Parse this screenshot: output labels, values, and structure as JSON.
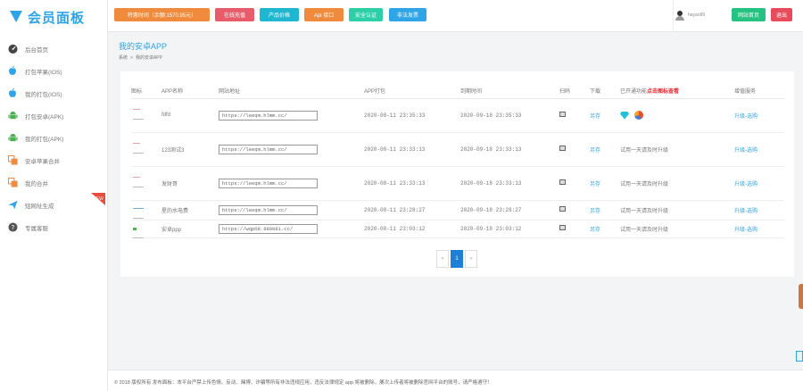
{
  "logo": {
    "text": "会员面板"
  },
  "sidebar": {
    "items": [
      {
        "label": "后台首页",
        "icon": "dashboard-icon"
      },
      {
        "label": "打包苹果(IOS)",
        "icon": "apple-icon"
      },
      {
        "label": "我的打包(IOS)",
        "icon": "apple-icon"
      },
      {
        "label": "打包安卓(APK)",
        "icon": "android-icon"
      },
      {
        "label": "我的打包(APK)",
        "icon": "android-icon"
      },
      {
        "label": "安卓苹果合并",
        "icon": "merge-icon"
      },
      {
        "label": "我的合并",
        "icon": "merge-icon"
      },
      {
        "label": "短网址生成",
        "icon": "plane-icon",
        "badge": "NEW"
      },
      {
        "label": "专属客服",
        "icon": "help-icon"
      }
    ]
  },
  "topbar": {
    "buttons": [
      {
        "label": "特惠时间（余额:1570.95元）",
        "color": "#f08a3c"
      },
      {
        "label": "在线充值",
        "color": "#e85c6a"
      },
      {
        "label": "产品价格",
        "color": "#1fb6cf"
      },
      {
        "label": "Api 接口",
        "color": "#f08a3c"
      },
      {
        "label": "安全认证",
        "color": "#2ccfa8"
      },
      {
        "label": "非法发票",
        "color": "#2fa4e7"
      }
    ],
    "username": "hayao99",
    "home_label": "网站首页",
    "logout_label": "退出",
    "home_color": "#26c281",
    "logout_color": "#e84c5c"
  },
  "main": {
    "title": "我的安卓APP",
    "breadcrumb": [
      "系统",
      "我的安卓APP"
    ]
  },
  "table": {
    "headers": [
      "图标",
      "APP名称",
      "网站地址",
      "APP打包",
      "到期时间",
      "扫码",
      "下载",
      "已开通功能",
      "点击图标查看",
      "增值服务"
    ],
    "rows": [
      {
        "name": "fdfd",
        "url": "https://leeqm.hlmm.cc/",
        "created": "2020-08-11 23:35:33",
        "expires": "2020-09-18 23:35:33",
        "download": "另存",
        "features": "",
        "service": "升级-选购"
      },
      {
        "name": "123测试3",
        "url": "https://leeqm.hlmm.cc/",
        "created": "2020-08-11 23:33:13",
        "expires": "2020-09-18 23:33:13",
        "download": "另存",
        "features": "试用一天请及时升级",
        "service": "升级-选购"
      },
      {
        "name": "发财哥",
        "url": "https://leeqm.hlmm.cc/",
        "created": "2020-08-11 23:33:13",
        "expires": "2020-09-18 23:33:13",
        "download": "另存",
        "features": "试用一天请及时升级",
        "service": "升级-选购"
      },
      {
        "name": "星的水电费",
        "url": "https://leeqm.hlmm.cc/",
        "created": "2020-08-11 23:28:27",
        "expires": "2020-09-18 23:28:27",
        "download": "另存",
        "features": "试用一天请及时升级",
        "service": "升级-选购"
      },
      {
        "name": "安卓ppp",
        "url": "https://wqpO8.880081.cc/",
        "created": "2020-08-11 23:03:12",
        "expires": "2020-09-18 23:03:12",
        "download": "另存",
        "features": "试用一天请及时升级",
        "service": "升级-选购"
      }
    ]
  },
  "pager": {
    "prev": "«",
    "current": "1",
    "next": "»"
  },
  "footer": {
    "text": "© 2018 版权所有 发布面板：本平台严禁上传色情、反动、赌博、诈骗等所有非法违规应用，违反法律规定 app 将被删除，屡次上传者将被删除官网平台的账号，请严格遵守！"
  }
}
